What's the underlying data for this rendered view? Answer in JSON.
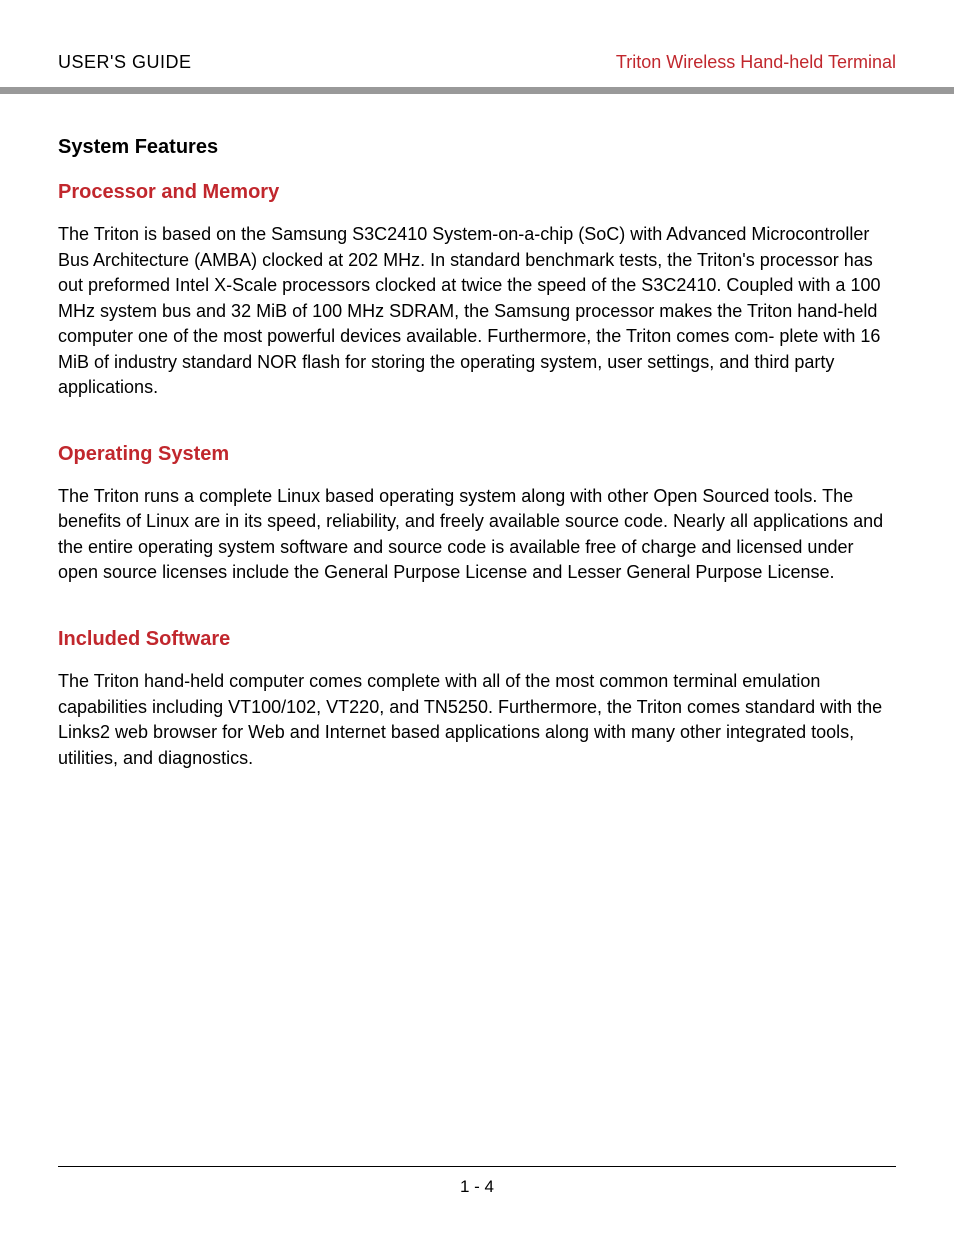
{
  "header": {
    "left": "USER'S GUIDE",
    "right": "Triton Wireless Hand-held Terminal"
  },
  "sections": {
    "title": "System Features",
    "processor": {
      "heading": "Processor and Memory",
      "body": "The Triton is based on the Samsung S3C2410 System-on-a-chip (SoC) with Advanced Microcontroller Bus Architecture (AMBA) clocked at 202 MHz. In standard benchmark tests, the Triton's processor has out preformed Intel X-Scale processors clocked at twice the speed of the S3C2410. Coupled with a 100 MHz system bus and 32 MiB of 100 MHz SDRAM, the Samsung processor makes the Triton hand-held computer one of the most powerful devices available. Furthermore, the Triton comes com- plete with 16 MiB of industry standard NOR flash for storing the operating system, user settings, and third party applications."
    },
    "os": {
      "heading": "Operating System",
      "body": "The Triton runs a complete Linux based operating system along with other Open Sourced tools. The benefits of Linux are in its speed, reliability, and freely available source code. Nearly all applications and the entire operating system software and source code is available free of charge and licensed under open source licenses include the General Purpose License and Lesser General Purpose License."
    },
    "software": {
      "heading": "Included Software",
      "body": "The Triton hand-held computer comes complete with all of the most common terminal emulation capabilities including VT100/102, VT220, and TN5250. Furthermore, the Triton comes standard with the Links2 web browser for Web and Internet based applications along with many other integrated tools, utilities, and diagnostics."
    }
  },
  "footer": {
    "page": "1 - 4"
  }
}
